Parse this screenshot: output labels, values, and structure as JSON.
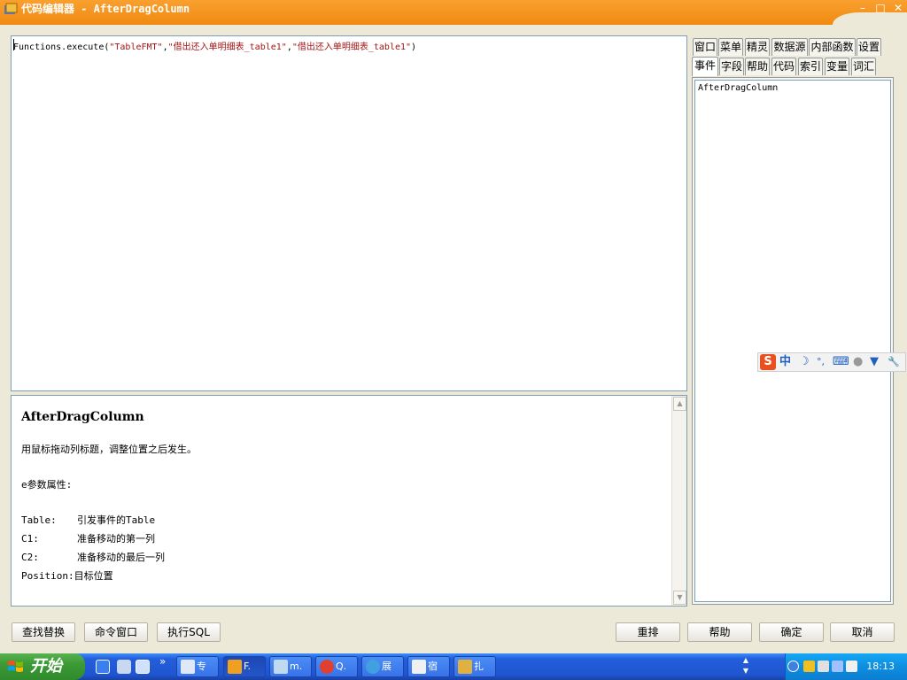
{
  "window": {
    "title": "代码编辑器 - AfterDragColumn",
    "minimize": "–",
    "maximize": "□",
    "close": "✕"
  },
  "editor": {
    "code_prefix": "Functions.execute(",
    "arg1": "\"TableFMT\"",
    "sep1": ",",
    "arg2": "\"借出还入单明细表_table1\"",
    "sep2": ",",
    "arg3": "\"借出还入单明细表_table1\"",
    "code_suffix": ")"
  },
  "help": {
    "title": "AfterDragColumn",
    "description": "用鼠标拖动列标题，调整位置之后发生。",
    "params_header": "e参数属性:",
    "params": [
      {
        "key": "Table:",
        "value": "引发事件的Table"
      },
      {
        "key": "C1:",
        "value": "准备移动的第一列"
      },
      {
        "key": "C2:",
        "value": "准备移动的最后一列"
      },
      {
        "key": "Position:",
        "value": "目标位置"
      }
    ]
  },
  "tabs": {
    "row1": [
      "窗口",
      "菜单",
      "精灵",
      "数据源",
      "内部函数",
      "设置"
    ],
    "row2": [
      "事件",
      "字段",
      "帮助",
      "代码",
      "索引",
      "变量",
      "词汇"
    ],
    "active": "事件"
  },
  "tree": {
    "items": [
      "AfterDragColumn"
    ]
  },
  "ime": {
    "logo": "S",
    "mode": "中",
    "moon": "☽",
    "punct": "°,",
    "keyboard": "⌨",
    "user": "●",
    "skin": "▼",
    "tools": "🔧"
  },
  "buttons": {
    "find_replace": "查找替换",
    "command_window": "命令窗口",
    "execute_sql": "执行SQL",
    "rearrange": "重排",
    "help": "帮助",
    "ok": "确定",
    "cancel": "取消"
  },
  "taskbar": {
    "start": "开始",
    "chevron": "»",
    "tasks": [
      "专",
      "F.",
      "m.",
      "Q.",
      "展",
      "宿",
      "扎"
    ],
    "clock": "18:13"
  },
  "colors": {
    "titlebar": "#f08a10",
    "taskbar": "#245edb",
    "start": "#3c9a36",
    "string": "#a31515"
  }
}
